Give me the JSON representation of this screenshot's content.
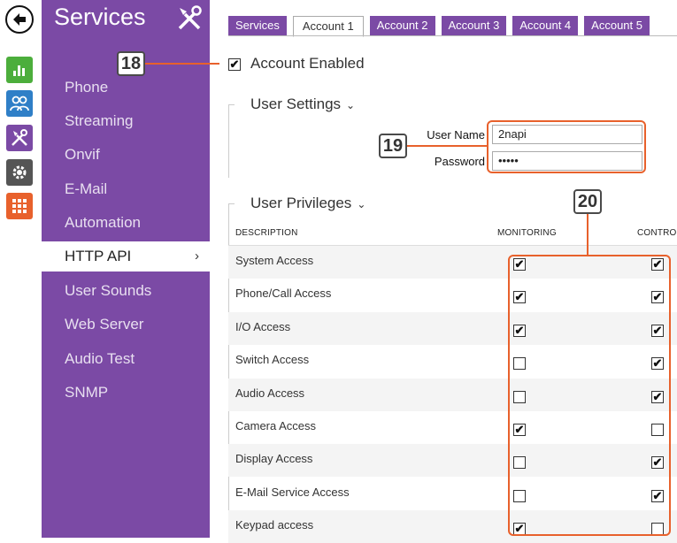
{
  "sidebar": {
    "title": "Services",
    "items": [
      {
        "label": "Phone"
      },
      {
        "label": "Streaming"
      },
      {
        "label": "Onvif"
      },
      {
        "label": "E-Mail"
      },
      {
        "label": "Automation"
      },
      {
        "label": "HTTP API",
        "active": true
      },
      {
        "label": "User Sounds"
      },
      {
        "label": "Web Server"
      },
      {
        "label": "Audio Test"
      },
      {
        "label": "SNMP"
      }
    ],
    "active_chevron": "›"
  },
  "rail": {
    "icons": [
      "back-arrow-icon",
      "bar-chart-icon",
      "users-icon",
      "tools-icon",
      "gear-icon",
      "grid-icon"
    ],
    "colors": {
      "green": "#4cae3c",
      "blue": "#2f7fc7",
      "purple": "#7b4aa5",
      "gray": "#555555",
      "orange": "#e8612c"
    }
  },
  "tabs": [
    "Services",
    "Account 1",
    "Account 2",
    "Account 3",
    "Account 4",
    "Account 5"
  ],
  "active_tab": "Account 1",
  "account": {
    "enabled_label": "Account Enabled",
    "enabled": true
  },
  "user_settings": {
    "title": "User Settings",
    "caret": "⌄",
    "username_label": "User Name",
    "username_value": "2napi",
    "password_label": "Password",
    "password_value": "•••••"
  },
  "privileges": {
    "title": "User Privileges",
    "caret": "⌄",
    "columns": [
      "DESCRIPTION",
      "MONITORING",
      "CONTROL"
    ],
    "rows": [
      {
        "label": "System Access",
        "monitoring": true,
        "control": true
      },
      {
        "label": "Phone/Call Access",
        "monitoring": true,
        "control": true
      },
      {
        "label": "I/O Access",
        "monitoring": true,
        "control": true
      },
      {
        "label": "Switch Access",
        "monitoring": false,
        "control": true
      },
      {
        "label": "Audio Access",
        "monitoring": false,
        "control": true
      },
      {
        "label": "Camera Access",
        "monitoring": true,
        "control": false
      },
      {
        "label": "Display Access",
        "monitoring": false,
        "control": true
      },
      {
        "label": "E-Mail Service Access",
        "monitoring": false,
        "control": true
      },
      {
        "label": "Keypad access",
        "monitoring": true,
        "control": false
      }
    ]
  },
  "annotations": {
    "callout_18": "18",
    "callout_19": "19",
    "callout_20": "20",
    "color": "#e8612c"
  }
}
